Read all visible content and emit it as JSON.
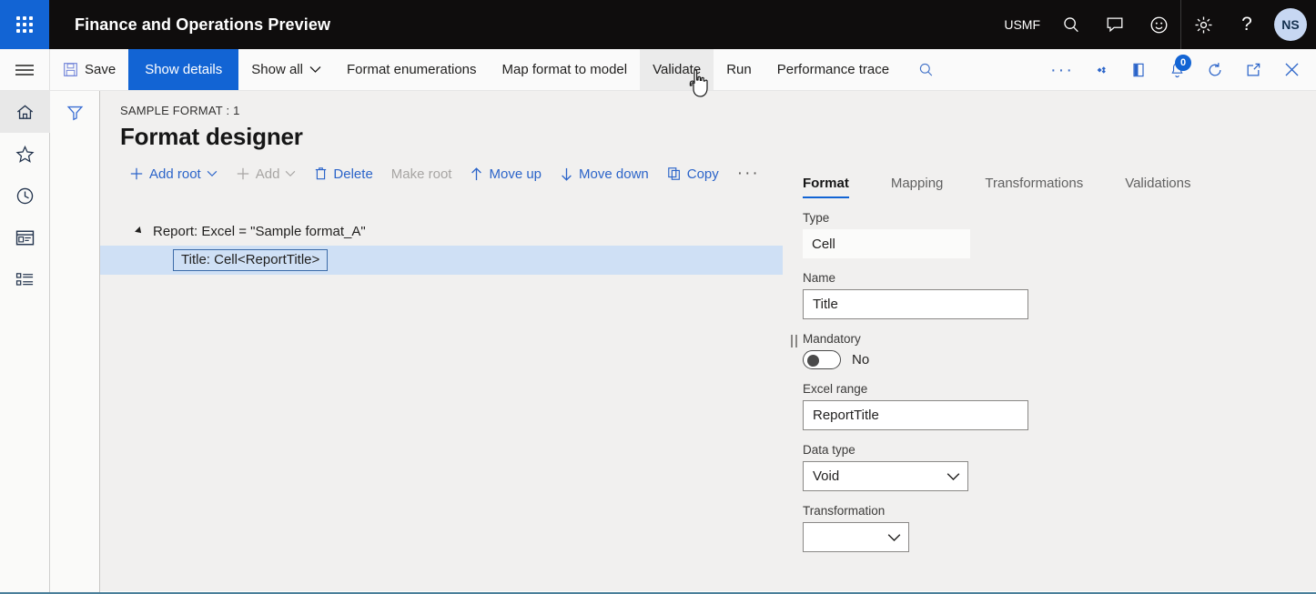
{
  "appbar": {
    "waffle_icon": "waffle-grid-icon",
    "title": "Finance and Operations Preview",
    "company": "USMF",
    "search_icon": "search-icon",
    "feedback_icon": "speech-bubble-icon",
    "smiley_icon": "smiley-icon",
    "settings_icon": "gear-icon",
    "help_icon": "question-mark-icon",
    "avatar_initials": "NS"
  },
  "commandbar": {
    "hamburger_icon": "hamburger-menu-icon",
    "save_label": "Save",
    "save_icon": "save-disk-icon",
    "show_details_label": "Show details",
    "show_all_label": "Show all",
    "format_enumerations_label": "Format enumerations",
    "map_format_to_model_label": "Map format to model",
    "validate_label": "Validate",
    "run_label": "Run",
    "performance_trace_label": "Performance trace",
    "search_icon": "search-icon",
    "more_icon": "more-ellipsis-icon",
    "attachments_icon": "diamond-attachments-icon",
    "office_icon": "office-app-icon",
    "notifications_icon": "notifications-bell-icon",
    "notifications_count": "0",
    "refresh_icon": "refresh-icon",
    "popout_icon": "open-in-new-window-icon",
    "close_icon": "close-x-icon"
  },
  "rail": {
    "items": [
      {
        "name": "home",
        "icon": "home-icon",
        "selected": true
      },
      {
        "name": "favorites",
        "icon": "star-icon",
        "selected": false
      },
      {
        "name": "recent",
        "icon": "clock-icon",
        "selected": false
      },
      {
        "name": "workspaces",
        "icon": "workspace-window-icon",
        "selected": false
      },
      {
        "name": "modules",
        "icon": "list-modules-icon",
        "selected": false
      }
    ],
    "filter_icon": "filter-funnel-icon"
  },
  "page": {
    "breadcrumb": "SAMPLE FORMAT : 1",
    "title": "Format designer"
  },
  "tree_actions": [
    {
      "label": "Add root",
      "icon": "plus-icon",
      "caret": true,
      "disabled": false
    },
    {
      "label": "Add",
      "icon": "plus-icon",
      "caret": true,
      "disabled": true
    },
    {
      "label": "Delete",
      "icon": "trash-icon",
      "caret": false,
      "disabled": false
    },
    {
      "label": "Make root",
      "icon": "",
      "caret": false,
      "disabled": true
    },
    {
      "label": "Move up",
      "icon": "arrow-up-icon",
      "caret": false,
      "disabled": false
    },
    {
      "label": "Move down",
      "icon": "arrow-down-icon",
      "caret": false,
      "disabled": false
    },
    {
      "label": "Copy",
      "icon": "copy-icon",
      "caret": false,
      "disabled": false
    }
  ],
  "tree_more_label": "···",
  "tree": {
    "root_label": "Report: Excel = \"Sample format_A\"",
    "child_label": "Title: Cell<ReportTitle>"
  },
  "detail": {
    "tabs": [
      {
        "label": "Format",
        "active": true
      },
      {
        "label": "Mapping",
        "active": false
      },
      {
        "label": "Transformations",
        "active": false
      },
      {
        "label": "Validations",
        "active": false
      }
    ],
    "fields": {
      "type_label": "Type",
      "type_value": "Cell",
      "name_label": "Name",
      "name_value": "Title",
      "mandatory_label": "Mandatory",
      "mandatory_value": "No",
      "excel_range_label": "Excel range",
      "excel_range_value": "ReportTitle",
      "data_type_label": "Data type",
      "data_type_value": "Void",
      "transformation_label": "Transformation",
      "transformation_value": ""
    }
  },
  "colors": {
    "accent": "#1264d4",
    "appbar_bg": "#0f0d0d",
    "selection_bg": "#cfe0f5",
    "content_bg": "#f1f0ef"
  }
}
